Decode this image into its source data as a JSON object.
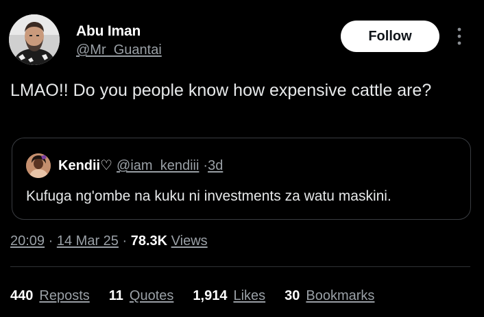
{
  "author": {
    "display_name": "Abu Iman",
    "handle": "@Mr_Guantai"
  },
  "follow_button": {
    "label": "Follow"
  },
  "more_icon": "more-vertical-icon",
  "tweet": {
    "text": "LMAO!! Do you people know how expensive cattle are?"
  },
  "quoted_tweet": {
    "display_name": "Kendii♡",
    "handle": "@iam_kendiii",
    "separator": "·",
    "time": "3d",
    "text": "Kufuga ng'ombe na kuku ni investments za watu maskini."
  },
  "meta": {
    "time": "20:09",
    "separator": "·",
    "date": "14 Mar 25",
    "views_count": "78.3K",
    "views_label": "Views"
  },
  "stats": {
    "reposts_count": "440",
    "reposts_label": "Reposts",
    "quotes_count": "11",
    "quotes_label": "Quotes",
    "likes_count": "1,914",
    "likes_label": "Likes",
    "bookmarks_count": "30",
    "bookmarks_label": "Bookmarks"
  },
  "colors": {
    "background": "#000000",
    "text_primary": "#e7e9ea",
    "text_secondary": "#9aa0a6",
    "border": "#3a3d42",
    "button_bg": "#ffffff"
  }
}
